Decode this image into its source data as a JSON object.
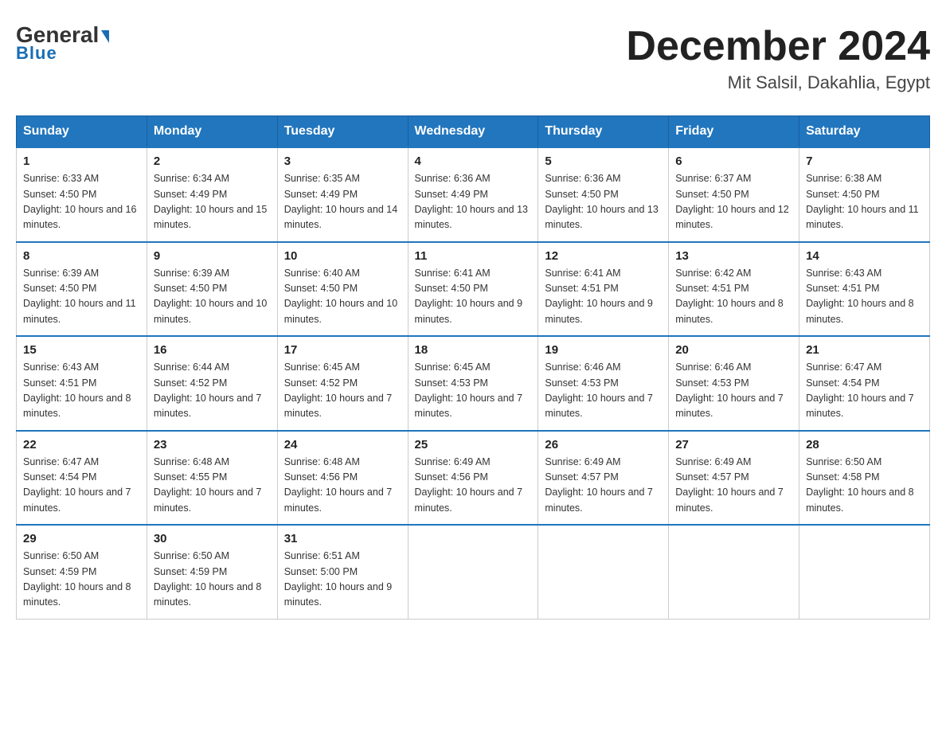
{
  "header": {
    "logo_general": "General",
    "logo_blue": "Blue",
    "month_title": "December 2024",
    "location": "Mit Salsil, Dakahlia, Egypt"
  },
  "days_of_week": [
    "Sunday",
    "Monday",
    "Tuesday",
    "Wednesday",
    "Thursday",
    "Friday",
    "Saturday"
  ],
  "weeks": [
    [
      {
        "day": "1",
        "sunrise": "6:33 AM",
        "sunset": "4:50 PM",
        "daylight": "10 hours and 16 minutes."
      },
      {
        "day": "2",
        "sunrise": "6:34 AM",
        "sunset": "4:49 PM",
        "daylight": "10 hours and 15 minutes."
      },
      {
        "day": "3",
        "sunrise": "6:35 AM",
        "sunset": "4:49 PM",
        "daylight": "10 hours and 14 minutes."
      },
      {
        "day": "4",
        "sunrise": "6:36 AM",
        "sunset": "4:49 PM",
        "daylight": "10 hours and 13 minutes."
      },
      {
        "day": "5",
        "sunrise": "6:36 AM",
        "sunset": "4:50 PM",
        "daylight": "10 hours and 13 minutes."
      },
      {
        "day": "6",
        "sunrise": "6:37 AM",
        "sunset": "4:50 PM",
        "daylight": "10 hours and 12 minutes."
      },
      {
        "day": "7",
        "sunrise": "6:38 AM",
        "sunset": "4:50 PM",
        "daylight": "10 hours and 11 minutes."
      }
    ],
    [
      {
        "day": "8",
        "sunrise": "6:39 AM",
        "sunset": "4:50 PM",
        "daylight": "10 hours and 11 minutes."
      },
      {
        "day": "9",
        "sunrise": "6:39 AM",
        "sunset": "4:50 PM",
        "daylight": "10 hours and 10 minutes."
      },
      {
        "day": "10",
        "sunrise": "6:40 AM",
        "sunset": "4:50 PM",
        "daylight": "10 hours and 10 minutes."
      },
      {
        "day": "11",
        "sunrise": "6:41 AM",
        "sunset": "4:50 PM",
        "daylight": "10 hours and 9 minutes."
      },
      {
        "day": "12",
        "sunrise": "6:41 AM",
        "sunset": "4:51 PM",
        "daylight": "10 hours and 9 minutes."
      },
      {
        "day": "13",
        "sunrise": "6:42 AM",
        "sunset": "4:51 PM",
        "daylight": "10 hours and 8 minutes."
      },
      {
        "day": "14",
        "sunrise": "6:43 AM",
        "sunset": "4:51 PM",
        "daylight": "10 hours and 8 minutes."
      }
    ],
    [
      {
        "day": "15",
        "sunrise": "6:43 AM",
        "sunset": "4:51 PM",
        "daylight": "10 hours and 8 minutes."
      },
      {
        "day": "16",
        "sunrise": "6:44 AM",
        "sunset": "4:52 PM",
        "daylight": "10 hours and 7 minutes."
      },
      {
        "day": "17",
        "sunrise": "6:45 AM",
        "sunset": "4:52 PM",
        "daylight": "10 hours and 7 minutes."
      },
      {
        "day": "18",
        "sunrise": "6:45 AM",
        "sunset": "4:53 PM",
        "daylight": "10 hours and 7 minutes."
      },
      {
        "day": "19",
        "sunrise": "6:46 AM",
        "sunset": "4:53 PM",
        "daylight": "10 hours and 7 minutes."
      },
      {
        "day": "20",
        "sunrise": "6:46 AM",
        "sunset": "4:53 PM",
        "daylight": "10 hours and 7 minutes."
      },
      {
        "day": "21",
        "sunrise": "6:47 AM",
        "sunset": "4:54 PM",
        "daylight": "10 hours and 7 minutes."
      }
    ],
    [
      {
        "day": "22",
        "sunrise": "6:47 AM",
        "sunset": "4:54 PM",
        "daylight": "10 hours and 7 minutes."
      },
      {
        "day": "23",
        "sunrise": "6:48 AM",
        "sunset": "4:55 PM",
        "daylight": "10 hours and 7 minutes."
      },
      {
        "day": "24",
        "sunrise": "6:48 AM",
        "sunset": "4:56 PM",
        "daylight": "10 hours and 7 minutes."
      },
      {
        "day": "25",
        "sunrise": "6:49 AM",
        "sunset": "4:56 PM",
        "daylight": "10 hours and 7 minutes."
      },
      {
        "day": "26",
        "sunrise": "6:49 AM",
        "sunset": "4:57 PM",
        "daylight": "10 hours and 7 minutes."
      },
      {
        "day": "27",
        "sunrise": "6:49 AM",
        "sunset": "4:57 PM",
        "daylight": "10 hours and 7 minutes."
      },
      {
        "day": "28",
        "sunrise": "6:50 AM",
        "sunset": "4:58 PM",
        "daylight": "10 hours and 8 minutes."
      }
    ],
    [
      {
        "day": "29",
        "sunrise": "6:50 AM",
        "sunset": "4:59 PM",
        "daylight": "10 hours and 8 minutes."
      },
      {
        "day": "30",
        "sunrise": "6:50 AM",
        "sunset": "4:59 PM",
        "daylight": "10 hours and 8 minutes."
      },
      {
        "day": "31",
        "sunrise": "6:51 AM",
        "sunset": "5:00 PM",
        "daylight": "10 hours and 9 minutes."
      },
      null,
      null,
      null,
      null
    ]
  ]
}
